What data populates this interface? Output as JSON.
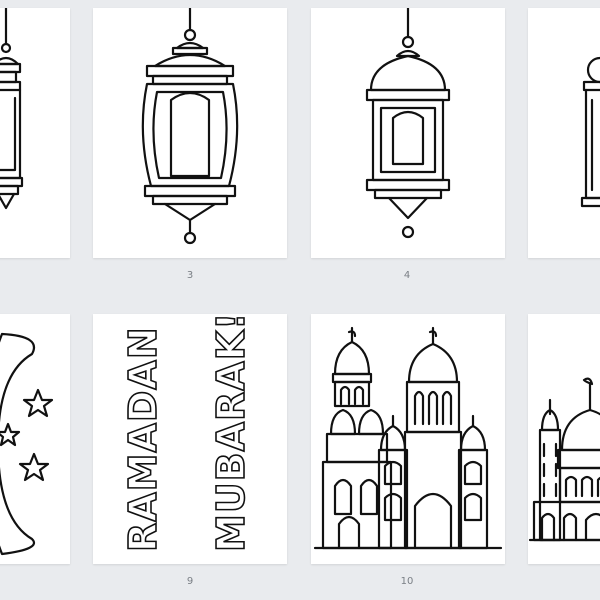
{
  "pages": [
    {
      "number": "",
      "subject": "lantern"
    },
    {
      "number": "3",
      "subject": "lantern"
    },
    {
      "number": "4",
      "subject": "lantern"
    },
    {
      "number": "",
      "subject": "lantern"
    },
    {
      "number": "",
      "subject": "crescent-moon-and-stars"
    },
    {
      "number": "9",
      "subject": "ramadan-mubarak-text",
      "text_left": "RAMADAN",
      "text_right": "MUBARAK!"
    },
    {
      "number": "10",
      "subject": "mosque"
    },
    {
      "number": "",
      "subject": "mosque"
    }
  ],
  "colors": {
    "background": "#e9ebee",
    "page": "#ffffff",
    "line": "#111111",
    "page_number": "#7a7f85"
  }
}
